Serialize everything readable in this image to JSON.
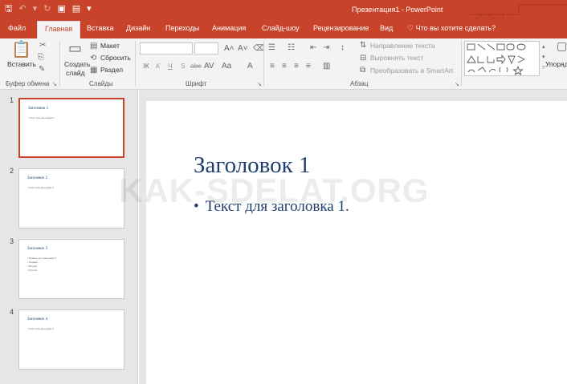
{
  "app": {
    "window_title": "Презентация1 - PowerPoint",
    "watermark": "KAK-SDELAT.ORG"
  },
  "qat": {
    "save": "🖫",
    "undo": "↶",
    "undo_arrow": "▾",
    "redo": "↻",
    "slideshow": "▣",
    "newslide": "▤",
    "customize": "▾"
  },
  "tabs": [
    {
      "label": "Файл"
    },
    {
      "label": "Главная"
    },
    {
      "label": "Вставка"
    },
    {
      "label": "Дизайн"
    },
    {
      "label": "Переходы"
    },
    {
      "label": "Анимация"
    },
    {
      "label": "Слайд-шоу"
    },
    {
      "label": "Рецензирование"
    },
    {
      "label": "Вид"
    }
  ],
  "tell_me": "Что вы хотите сделать?",
  "ribbon": {
    "clipboard": {
      "paste": "Вставить",
      "label": "Буфер обмена"
    },
    "slides": {
      "new_slide_1": "Создать",
      "new_slide_2": "слайд",
      "layout": "Макет",
      "reset": "Сбросить",
      "section": "Раздел",
      "label": "Слайды"
    },
    "font": {
      "bold": "Ж",
      "italic": "К",
      "underline": "Ч",
      "strike": "S",
      "spacing": "abc",
      "label": "Шрифт"
    },
    "paragraph": {
      "text_dir": "Направление текста",
      "align_text": "Выровнять текст",
      "smartart": "Преобразовать в SmartArt",
      "label": "Абзац"
    },
    "drawing": {
      "arrange": "Упоряд"
    }
  },
  "slides": [
    {
      "num": "1",
      "title": "Заголовок 1",
      "lines": [
        "• Текст для заголовка 1"
      ]
    },
    {
      "num": "2",
      "title": "Заголовок 2",
      "lines": [
        "• Текст для заголовка 2"
      ]
    },
    {
      "num": "3",
      "title": "Заголовок 3",
      "lines": [
        "• Пример для заголовка 3",
        "• Первый",
        "• Второй",
        "• Третий"
      ]
    },
    {
      "num": "4",
      "title": "Заголовок 4",
      "lines": [
        "• Текст для заголовка 4"
      ]
    }
  ],
  "current_slide": {
    "title": "Заголовок 1",
    "bullet": "•",
    "text": "Текст для заголовка 1."
  },
  "colors": {
    "accent": "#c9432a",
    "slide_text": "#1f3f6e"
  }
}
